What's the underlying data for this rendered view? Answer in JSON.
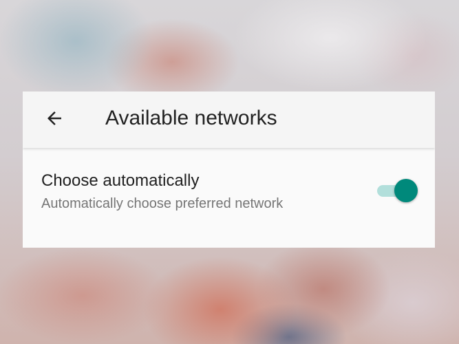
{
  "header": {
    "title": "Available networks",
    "back_icon": "arrow-back-icon"
  },
  "setting": {
    "title": "Choose automatically",
    "subtitle": "Automatically choose preferred network",
    "enabled": true
  },
  "colors": {
    "accent": "#00897b",
    "track_on": "#b2dfdb",
    "title_text": "#212121",
    "secondary_text": "#757575",
    "icon": "#212121"
  }
}
